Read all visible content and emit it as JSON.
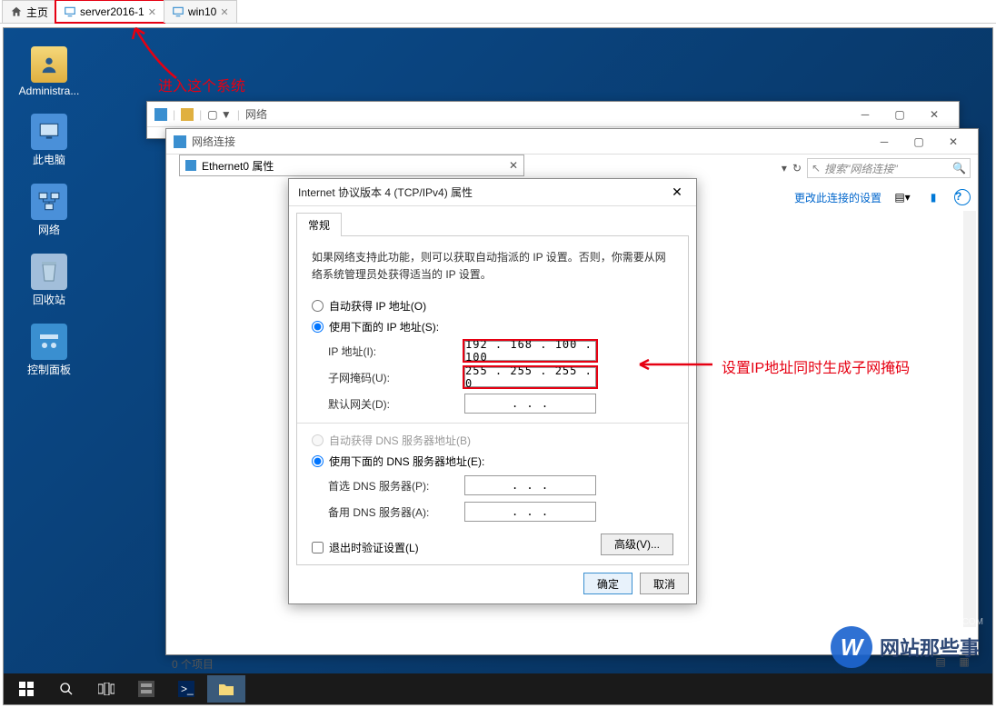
{
  "tabs": {
    "home": "主页",
    "vm1": "server2016-1",
    "vm2": "win10"
  },
  "annotations": {
    "enter_system": "进入这个系统",
    "set_ip": "设置IP地址同时生成子网掩码"
  },
  "desktop_icons": {
    "admin": "Administra...",
    "this_pc": "此电脑",
    "network": "网络",
    "recycle": "回收站",
    "control": "控制面板"
  },
  "bg_window1": {
    "title": "网络"
  },
  "bg_window2": {
    "title": "网络连接",
    "ethernet_tab": "Ethernet0 属性",
    "search_placeholder": "搜索\"网络连接\"",
    "change_settings": "更改此连接的设置"
  },
  "dialog": {
    "title": "Internet 协议版本 4 (TCP/IPv4) 属性",
    "tab_general": "常规",
    "description": "如果网络支持此功能，则可以获取自动指派的 IP 设置。否则，你需要从网络系统管理员处获得适当的 IP 设置。",
    "radio_auto_ip": "自动获得 IP 地址(O)",
    "radio_manual_ip": "使用下面的 IP 地址(S):",
    "label_ip": "IP 地址(I):",
    "label_mask": "子网掩码(U):",
    "label_gateway": "默认网关(D):",
    "radio_auto_dns": "自动获得 DNS 服务器地址(B)",
    "radio_manual_dns": "使用下面的 DNS 服务器地址(E):",
    "label_dns1": "首选 DNS 服务器(P):",
    "label_dns2": "备用 DNS 服务器(A):",
    "checkbox_validate": "退出时验证设置(L)",
    "btn_advanced": "高级(V)...",
    "btn_ok": "确定",
    "btn_cancel": "取消",
    "values": {
      "ip": "192 . 168 . 100 . 100",
      "mask": "255 . 255 . 255 .   0",
      "gateway": ".       .       .",
      "dns1": ".       .       .",
      "dns2": ".       .       ."
    }
  },
  "status": {
    "items": "0 个项目"
  },
  "watermark": {
    "letter": "W",
    "text": "网站那些事",
    "url": "www.wangzhanshi.COM"
  }
}
